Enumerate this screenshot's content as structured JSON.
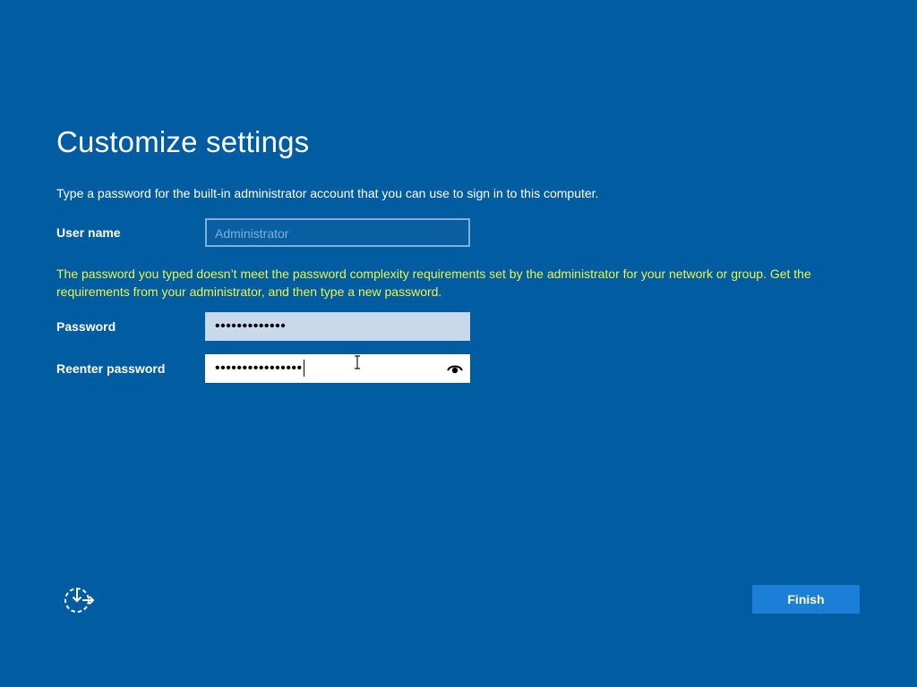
{
  "page": {
    "title": "Customize settings",
    "intro": "Type a password for the built-in administrator account that you can use to sign in to this computer."
  },
  "form": {
    "username_label": "User name",
    "username_placeholder": "Administrator",
    "error_message": "The password you typed doesn’t meet the password complexity requirements set by the administrator for your network or group. Get the requirements from your administrator, and then type a new password.",
    "password_label": "Password",
    "password_value": "•••••••••••••",
    "reenter_label": "Reenter password",
    "reenter_value": "••••••••••••••••"
  },
  "footer": {
    "finish_label": "Finish"
  },
  "icons": {
    "accessibility": "ease-of-access-icon",
    "reveal": "reveal-password-eye-icon",
    "cursor": "text-cursor-icon"
  },
  "colors": {
    "background": "#015ca2",
    "error_text": "#e8f54a",
    "button": "#1b7ed7"
  }
}
